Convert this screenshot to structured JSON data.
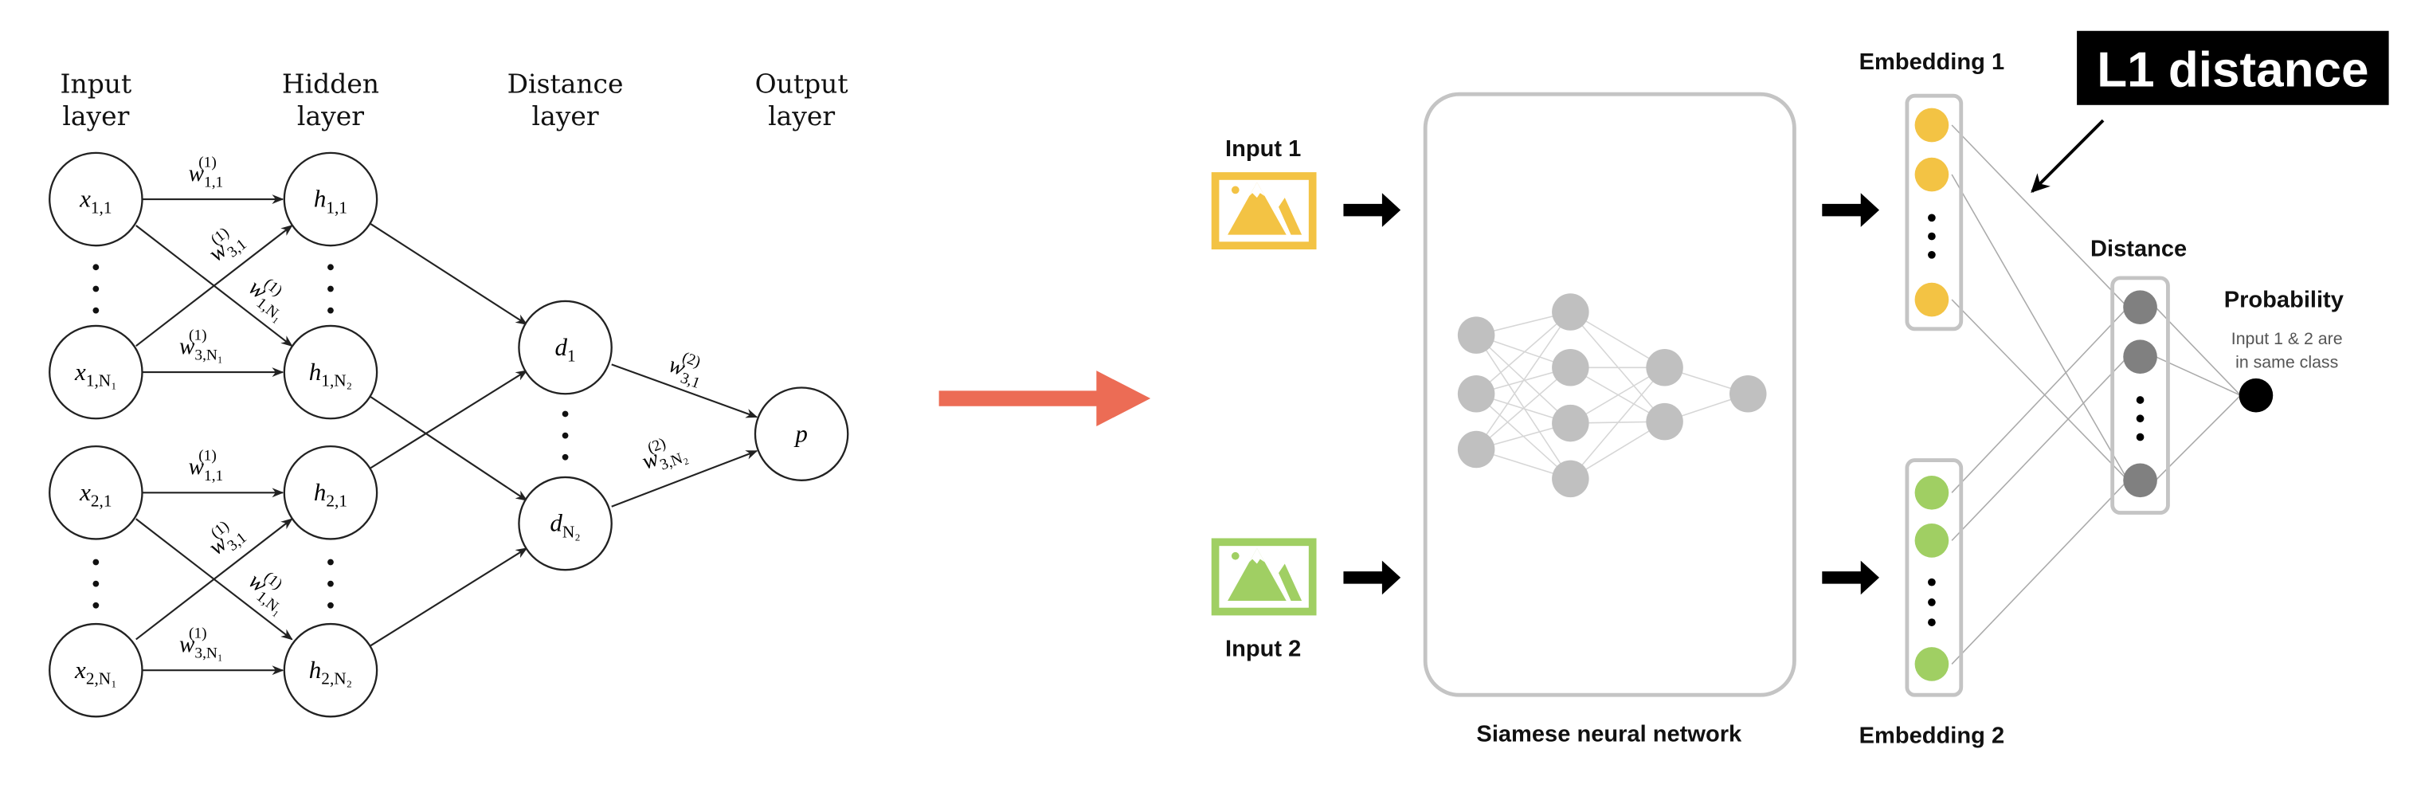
{
  "left_network": {
    "headers": [
      {
        "line1": "Input",
        "line2": "layer"
      },
      {
        "line1": "Hidden",
        "line2": "layer"
      },
      {
        "line1": "Distance",
        "line2": "layer"
      },
      {
        "line1": "Output",
        "line2": "layer"
      }
    ],
    "input_nodes": [
      {
        "base": "x",
        "sub": "1,1"
      },
      {
        "base": "x",
        "sub": "1,N₁"
      },
      {
        "base": "x",
        "sub": "2,1"
      },
      {
        "base": "x",
        "sub": "2,N₁"
      }
    ],
    "hidden_nodes": [
      {
        "base": "h",
        "sub": "1,1"
      },
      {
        "base": "h",
        "sub": "1,N₂"
      },
      {
        "base": "h",
        "sub": "2,1"
      },
      {
        "base": "h",
        "sub": "2,N₂"
      }
    ],
    "distance_nodes": [
      {
        "base": "d",
        "sub": "1"
      },
      {
        "base": "d",
        "sub": "N₂"
      }
    ],
    "output_node": {
      "base": "p",
      "sub": ""
    },
    "weights": {
      "w11": {
        "base": "w",
        "sub": "1,1",
        "sup": "(1)"
      },
      "w31": {
        "base": "w",
        "sub": "3,1",
        "sup": "(1)"
      },
      "w1N": {
        "base": "w",
        "sub": "1,N₁",
        "sup": "(1)"
      },
      "w3N": {
        "base": "w",
        "sub": "3,N₁",
        "sup": "(1)"
      },
      "w2_31": {
        "base": "w",
        "sub": "3,1",
        "sup": "(2)"
      },
      "w2_3N": {
        "base": "w",
        "sub": "3,N₂",
        "sup": "(2)"
      }
    }
  },
  "transition_arrow": {
    "color": "#ec6c55"
  },
  "siamese": {
    "input1_label": "Input 1",
    "input2_label": "Input 2",
    "network_label": "Siamese neural network",
    "embedding1_label": "Embedding 1",
    "embedding2_label": "Embedding 2",
    "distance_label": "Distance",
    "probability_label": "Probability",
    "probability_desc_line1": "Input 1 & 2 are",
    "probability_desc_line2": "in same class",
    "callout_label": "L1 distance",
    "colors": {
      "input1": "#f3c344",
      "input2": "#a0cf63",
      "nn_node": "#c0c0c0",
      "distance_node": "#808080",
      "output_node": "#000000",
      "box_border": "#c4c4c4"
    }
  }
}
